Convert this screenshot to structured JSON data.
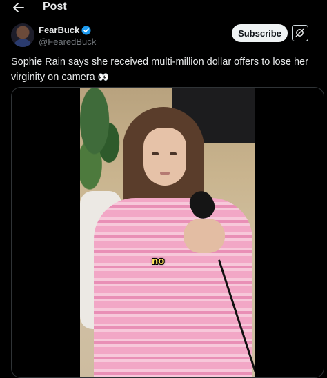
{
  "header": {
    "title": "Post"
  },
  "post": {
    "author_name": "FearBuck",
    "author_handle": "@FearedBuck",
    "subscribe_label": "Subscribe",
    "text": "Sophie Rain says she received multi-million dollar offers to lose her virginity on camera",
    "emoji": "👀",
    "media": {
      "caption_text": "no"
    }
  },
  "icons": {
    "back": "back-arrow-icon",
    "verified": "verified-badge-icon",
    "grok": "grok-icon"
  },
  "colors": {
    "background": "#000000",
    "text": "#e7e9ea",
    "secondary_text": "#71767b",
    "verified_blue": "#1d9bf0",
    "subscribe_bg": "#eff3f4",
    "caption_yellow": "#ffe45c"
  }
}
